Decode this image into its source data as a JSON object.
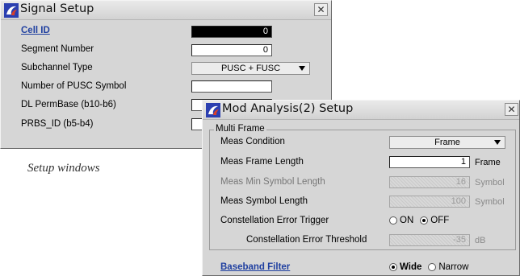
{
  "signal_setup": {
    "title": "Signal Setup",
    "close_label": "✕",
    "cell_id": {
      "label": "Cell ID",
      "value": "0"
    },
    "segment_number": {
      "label": "Segment Number",
      "value": "0"
    },
    "subchannel_type": {
      "label": "Subchannel Type",
      "value": "PUSC + FUSC"
    },
    "num_pusc_symbol": {
      "label": "Number of PUSC Symbol"
    },
    "dl_permbase": {
      "label": "DL PermBase (b10-b6)"
    },
    "prbs_id": {
      "label": "PRBS_ID (b5-b4)"
    }
  },
  "caption": "Setup windows",
  "mod_analysis": {
    "title": "Mod Analysis(2) Setup",
    "close_label": "✕",
    "multi_frame_legend": "Multi Frame",
    "meas_condition": {
      "label": "Meas Condition",
      "value": "Frame"
    },
    "meas_frame_length": {
      "label": "Meas Frame Length",
      "value": "1",
      "unit": "Frame"
    },
    "meas_min_symbol_length": {
      "label": "Meas Min Symbol Length",
      "value": "16",
      "unit": "Symbol"
    },
    "meas_symbol_length": {
      "label": "Meas Symbol Length",
      "value": "100",
      "unit": "Symbol"
    },
    "constellation_error_trigger": {
      "label": "Constellation Error Trigger",
      "options": [
        "ON",
        "OFF"
      ],
      "selected": "OFF"
    },
    "constellation_error_threshold": {
      "label": "Constellation Error Threshold",
      "value": "-35",
      "unit": "dB"
    },
    "baseband_filter": {
      "label": "Baseband Filter",
      "options": [
        "Wide",
        "Narrow"
      ],
      "selected": "Wide"
    }
  },
  "colors": {
    "link": "#1f3fa0",
    "window_bg": "#d6d6d6",
    "logo_blue": "#2b3fb0",
    "logo_red": "#d8402a"
  },
  "icons": {
    "title_icon": "anritsu-logo-icon",
    "close_icon": "close-icon",
    "dropdown_icon": "chevron-down-icon"
  }
}
